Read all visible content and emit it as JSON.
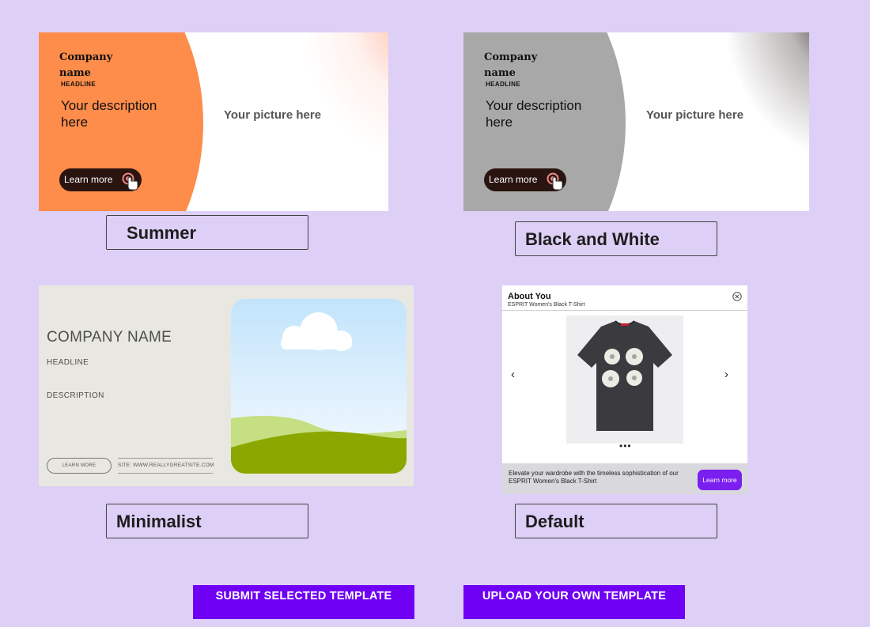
{
  "colors": {
    "background": "#ddcff5",
    "summer_accent": "#fe8c4a",
    "bw_accent": "#a8a8a8",
    "action_button": "#6f00f4",
    "default_cta": "#7b1ef0"
  },
  "templates": {
    "summer": {
      "label": "Summer",
      "preview": {
        "company": "Company name",
        "headline": "HEADLINE",
        "description": "Your description here",
        "picture": "Your picture here",
        "button": "Learn more",
        "cursor_icon": "hand-pointer-icon"
      }
    },
    "bw": {
      "label": "Black and White",
      "preview": {
        "company": "Company name",
        "headline": "HEADLINE",
        "description": "Your description here",
        "picture": "Your picture here",
        "button": "Learn more",
        "cursor_icon": "hand-pointer-icon"
      }
    },
    "minimalist": {
      "label": "Minimalist",
      "preview": {
        "company": "COMPANY NAME",
        "headline": "HEADLINE",
        "description": "DESCRIPTION",
        "button": "LEARN MORE",
        "site": "SITE: WWW.REALLYGREATSITE.COM",
        "picture_icon": "landscape-cloud-icon"
      }
    },
    "default": {
      "label": "Default",
      "preview": {
        "title": "About You",
        "subtitle": "ESPRIT Women's Black T-Shirt",
        "close_icon": "close-circle-icon",
        "prev_icon": "chevron-left-icon",
        "next_icon": "chevron-right-icon",
        "image_icon": "tshirt-icon",
        "dots": "•••",
        "footer_text": "Elevate your wardrobe with the timeless sophistication of our ESPRIT Women's Black T-Shirt",
        "footer_button": "Learn more"
      }
    }
  },
  "actions": {
    "submit": "SUBMIT SELECTED TEMPLATE",
    "upload": "UPLOAD YOUR OWN TEMPLATE"
  }
}
